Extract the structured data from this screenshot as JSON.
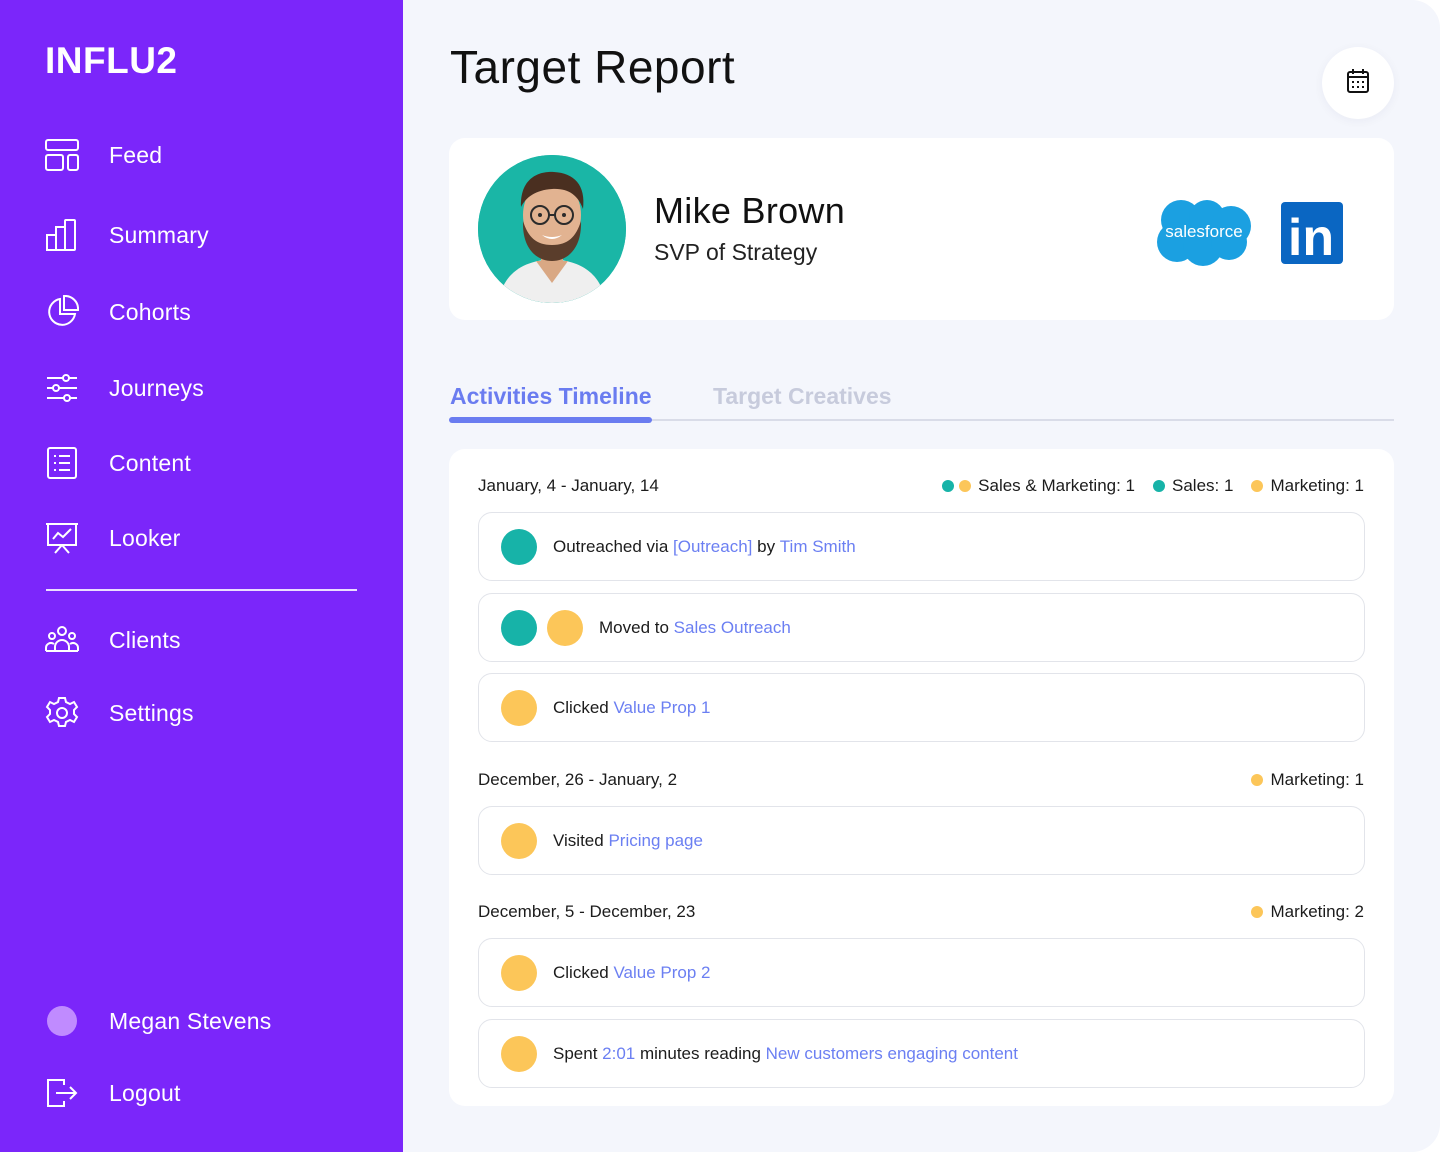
{
  "brand": {
    "logo": "INFLU2"
  },
  "colors": {
    "sidebar": "#7b26fa",
    "accent": "#6a7cf0",
    "teal": "#17b3a8",
    "yellow": "#fcc659"
  },
  "sidebar": {
    "items": [
      {
        "label": "Feed",
        "icon": "feed-icon"
      },
      {
        "label": "Summary",
        "icon": "bar-chart-icon"
      },
      {
        "label": "Cohorts",
        "icon": "pie-chart-icon"
      },
      {
        "label": "Journeys",
        "icon": "sliders-icon"
      },
      {
        "label": "Content",
        "icon": "list-icon"
      },
      {
        "label": "Looker",
        "icon": "presentation-icon"
      }
    ],
    "secondary": [
      {
        "label": "Clients",
        "icon": "users-icon"
      },
      {
        "label": "Settings",
        "icon": "gear-icon"
      }
    ],
    "user": {
      "name": "Megan Stevens"
    },
    "logout": "Logout"
  },
  "page": {
    "title": "Target Report"
  },
  "profile": {
    "name": "Mike Brown",
    "role": "SVP of Strategy",
    "integrations": [
      "salesforce",
      "in"
    ]
  },
  "tabs": [
    {
      "label": "Activities Timeline",
      "active": true
    },
    {
      "label": "Target Creatives",
      "active": false
    }
  ],
  "timeline": [
    {
      "range": "January, 4 - January, 14",
      "legend": [
        {
          "label": "Sales & Marketing: 1",
          "dots": [
            "teal",
            "yellow"
          ]
        },
        {
          "label": "Sales: 1",
          "dots": [
            "teal"
          ]
        },
        {
          "label": "Marketing: 1",
          "dots": [
            "yellow"
          ]
        }
      ],
      "activities": [
        {
          "dots": [
            "teal"
          ],
          "parts": [
            [
              "Outreached via ",
              false
            ],
            [
              "[Outreach]",
              true
            ],
            [
              " by ",
              false
            ],
            [
              "Tim Smith",
              true
            ]
          ]
        },
        {
          "dots": [
            "teal",
            "yellow"
          ],
          "parts": [
            [
              "Moved to ",
              false
            ],
            [
              "Sales Outreach",
              true
            ]
          ]
        },
        {
          "dots": [
            "yellow"
          ],
          "parts": [
            [
              "Clicked ",
              false
            ],
            [
              "Value Prop 1",
              true
            ]
          ]
        }
      ]
    },
    {
      "range": "December, 26 - January, 2",
      "legend": [
        {
          "label": "Marketing: 1",
          "dots": [
            "yellow"
          ]
        }
      ],
      "activities": [
        {
          "dots": [
            "yellow"
          ],
          "parts": [
            [
              "Visited ",
              false
            ],
            [
              "Pricing page",
              true
            ]
          ]
        }
      ]
    },
    {
      "range": "December, 5 - December, 23",
      "legend": [
        {
          "label": "Marketing: 2",
          "dots": [
            "yellow"
          ]
        }
      ],
      "activities": [
        {
          "dots": [
            "yellow"
          ],
          "parts": [
            [
              "Clicked ",
              false
            ],
            [
              "Value Prop 2",
              true
            ]
          ]
        },
        {
          "dots": [
            "yellow"
          ],
          "parts": [
            [
              "Spent ",
              false
            ],
            [
              "2:01",
              true
            ],
            [
              " minutes reading ",
              false
            ],
            [
              "New customers engaging content",
              true
            ]
          ]
        }
      ]
    }
  ]
}
